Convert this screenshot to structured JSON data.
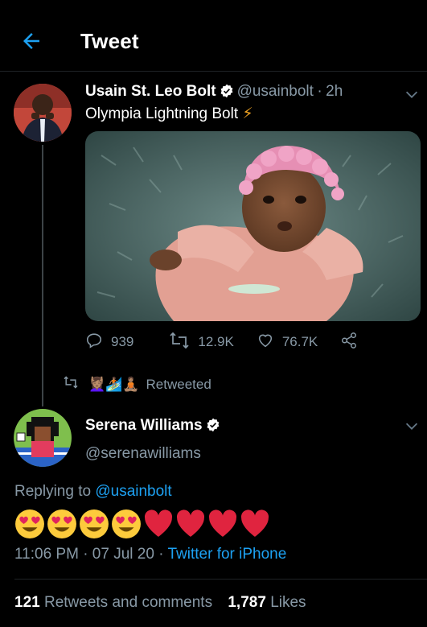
{
  "header": {
    "title": "Tweet"
  },
  "tweet": {
    "author_name": "Usain St. Leo Bolt",
    "author_handle": "@usainbolt",
    "time_sep": "·",
    "time": "2h",
    "text": "Olympia Lightning Bolt",
    "text_emoji": "⚡",
    "replies": "939",
    "retweets": "12.9K",
    "likes": "76.7K"
  },
  "retweet_row": {
    "emojis": "💆🏽‍♀️🏄🏽🧘🏽",
    "label": "Retweeted"
  },
  "reply": {
    "author_name": "Serena Williams",
    "author_handle": "@serenawilliams",
    "replying_label": "Replying to",
    "replying_handle": "@usainbolt",
    "time": "11:06 PM · 07 Jul 20 ·",
    "source": "Twitter for iPhone"
  },
  "stats": {
    "retweets_count": "121",
    "retweets_label": "Retweets and comments",
    "likes_count": "1,787",
    "likes_label": "Likes"
  },
  "colors": {
    "accent": "#1da1f2",
    "muted": "#8899a6",
    "background": "#000000"
  }
}
